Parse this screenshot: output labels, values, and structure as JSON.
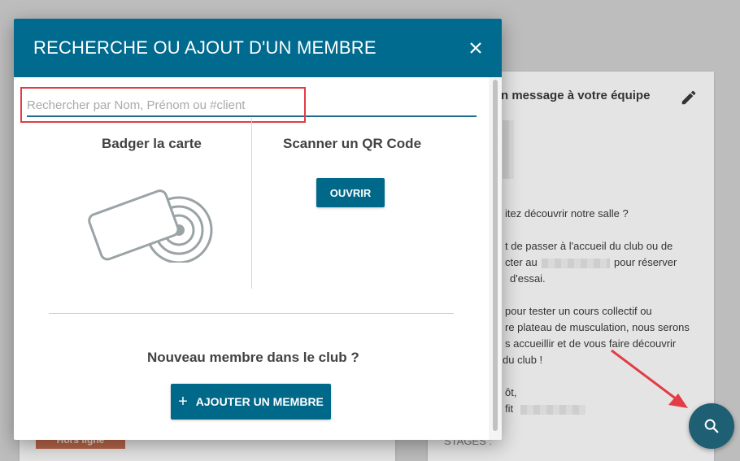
{
  "modal": {
    "title": "RECHERCHE OU AJOUT D'UN MEMBRE",
    "close_icon": "close-icon",
    "search": {
      "placeholder": "Rechercher par Nom, Prénom ou #client",
      "value": ""
    },
    "badge_section": {
      "title": "Badger la carte",
      "icon": "nfc-card-icon"
    },
    "qr_section": {
      "title": "Scanner un QR Code",
      "open_label": "OUVRIR"
    },
    "new_member": {
      "title": "Nouveau membre dans le club ?",
      "add_label": "AJOUTER UN MEMBRE",
      "add_icon": "+"
    }
  },
  "background": {
    "team_card": {
      "title": "n message à votre équipe",
      "lines": [
        "itez découvrir notre salle ?",
        "t de passer à l'accueil du club ou de",
        "cter au",
        "pour réserver",
        "d'essai.",
        "pour tester un cours collectif ou",
        "re plateau de musculation, nous serons",
        "s accueillir et de vous faire découvrir",
        "du club !",
        "ôt,",
        "fit"
      ],
      "stages_label": "STAGES :"
    },
    "offline_badge": "Hors ligne"
  },
  "fab": {
    "icon": "search-icon"
  },
  "colors": {
    "header": "#006b8f",
    "primary_button": "#00698a",
    "highlight": "#e23c46",
    "fab": "#1f5f73"
  }
}
